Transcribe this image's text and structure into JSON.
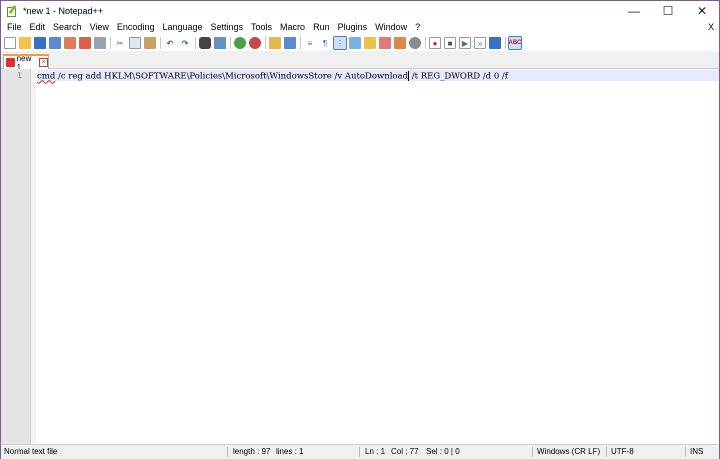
{
  "window": {
    "title": "*new 1 - Notepad++",
    "minimize": "—",
    "maximize": "☐",
    "close": "✕"
  },
  "menu": {
    "items": [
      "File",
      "Edit",
      "Search",
      "View",
      "Encoding",
      "Language",
      "Settings",
      "Tools",
      "Macro",
      "Run",
      "Plugins",
      "Window",
      "?"
    ],
    "close_document": "X"
  },
  "toolbar": {
    "icons": [
      "new-file-icon",
      "open-file-icon",
      "save-icon",
      "save-all-icon",
      "close-icon",
      "close-all-icon",
      "print-icon",
      "cut-icon",
      "copy-icon",
      "paste-icon",
      "undo-icon",
      "redo-icon",
      "find-icon",
      "replace-icon",
      "zoom-in-icon",
      "zoom-out-icon",
      "sync-vertical-icon",
      "sync-horizontal-icon",
      "word-wrap-icon",
      "show-all-characters-icon",
      "indent-guide-icon",
      "user-defined-language-icon",
      "document-map-icon",
      "function-list-icon",
      "folder-as-workspace-icon",
      "monitoring-icon",
      "record-macro-icon",
      "stop-recording-icon",
      "play-macro-icon",
      "run-macro-multiple-icon",
      "save-macro-icon",
      "spell-check-icon"
    ]
  },
  "tabs": [
    {
      "label": "new 1"
    }
  ],
  "editor": {
    "line_number": "1",
    "code_prefix": "cmd",
    "code_middle": " /c reg add HKLM\\SOFTWARE\\Policies\\Microsoft\\WindowsStore /v AutoDownload",
    "code_suffix": " /t REG_DWORD /d 0 /f"
  },
  "status": {
    "file_type": "Normal text file",
    "length": "length : 97",
    "lines": "lines : 1",
    "ln": "Ln : 1",
    "col": "Col : 77",
    "sel": "Sel : 0 | 0",
    "eol": "Windows (CR LF)",
    "encoding": "UTF-8",
    "mode": "INS"
  }
}
